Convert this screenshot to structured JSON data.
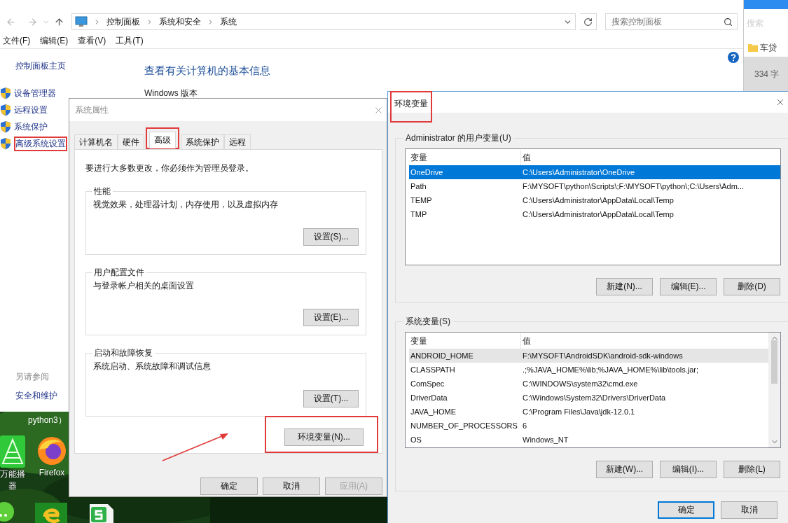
{
  "control_panel": {
    "breadcrumb": [
      "控制面板",
      "系统和安全",
      "系统"
    ],
    "search": {
      "placeholder": "搜索控制面板"
    },
    "menu": [
      "文件(F)",
      "编辑(E)",
      "查看(V)",
      "工具(T)"
    ],
    "sidebar": {
      "home": "控制面板主页",
      "items": [
        {
          "label": "设备管理器",
          "highlighted": false
        },
        {
          "label": "远程设置",
          "highlighted": false
        },
        {
          "label": "系统保护",
          "highlighted": false
        },
        {
          "label": "高级系统设置",
          "highlighted": true
        }
      ],
      "see_also_heading": "另请参阅",
      "see_also": [
        "安全和维护"
      ]
    },
    "heading": "查看有关计算机的基本信息",
    "section": "Windows 版本"
  },
  "side_app": {
    "search_placeholder": "搜索",
    "folder": "车贷",
    "word_count": "334 字"
  },
  "desktop": {
    "caption": "python3）",
    "icons": [
      {
        "kind": "triangle",
        "label_lines": [
          "万能播",
          "器"
        ]
      },
      {
        "kind": "firefox",
        "label_lines": [
          "Firefox"
        ]
      },
      {
        "kind": "chat"
      },
      {
        "kind": "e"
      },
      {
        "kind": "sheet"
      }
    ]
  },
  "system_properties": {
    "title": "系统属性",
    "tabs": [
      {
        "label": "计算机名",
        "selected": false,
        "highlighted": false
      },
      {
        "label": "硬件",
        "selected": false,
        "highlighted": false
      },
      {
        "label": "高级",
        "selected": true,
        "highlighted": true
      },
      {
        "label": "系统保护",
        "selected": false,
        "highlighted": false
      },
      {
        "label": "远程",
        "selected": false,
        "highlighted": false
      }
    ],
    "notice": "要进行大多数更改，你必须作为管理员登录。",
    "groups": [
      {
        "title": "性能",
        "description": "视觉效果，处理器计划，内存使用，以及虚拟内存",
        "button": "设置(S)..."
      },
      {
        "title": "用户配置文件",
        "description": "与登录帐户相关的桌面设置",
        "button": "设置(E)..."
      },
      {
        "title": "启动和故障恢复",
        "description": "系统启动、系统故障和调试信息",
        "button": "设置(T)..."
      }
    ],
    "env_button": {
      "label": "环境变量(N)...",
      "highlighted": true
    },
    "buttons": [
      {
        "label": "确定",
        "disabled": false
      },
      {
        "label": "取消",
        "disabled": false
      },
      {
        "label": "应用(A)",
        "disabled": true
      }
    ]
  },
  "environment_variables": {
    "title": "环境变量",
    "title_highlighted": true,
    "user_vars": {
      "label": "Administrator 的用户变量(U)",
      "focused": true,
      "columns": [
        "变量",
        "值"
      ],
      "rows": [
        {
          "name": "OneDrive",
          "value": "C:\\Users\\Administrator\\OneDrive",
          "selected": true
        },
        {
          "name": "Path",
          "value": "F:\\MYSOFT\\python\\Scripts\\;F:\\MYSOFT\\python\\;C:\\Users\\Adm...",
          "selected": false
        },
        {
          "name": "TEMP",
          "value": "C:\\Users\\Administrator\\AppData\\Local\\Temp",
          "selected": false
        },
        {
          "name": "TMP",
          "value": "C:\\Users\\Administrator\\AppData\\Local\\Temp",
          "selected": false
        }
      ],
      "buttons": [
        "新建(N)...",
        "编辑(E)...",
        "删除(D)"
      ]
    },
    "system_vars": {
      "label": "系统变量(S)",
      "focused": false,
      "columns": [
        "变量",
        "值"
      ],
      "rows": [
        {
          "name": "ANDROID_HOME",
          "value": "F:\\MYSOFT\\AndroidSDK\\android-sdk-windows",
          "selected": true
        },
        {
          "name": "CLASSPATH",
          "value": ".;%JAVA_HOME%\\lib;%JAVA_HOME%\\lib\\tools.jar;",
          "selected": false
        },
        {
          "name": "ComSpec",
          "value": "C:\\WINDOWS\\system32\\cmd.exe",
          "selected": false
        },
        {
          "name": "DriverData",
          "value": "C:\\Windows\\System32\\Drivers\\DriverData",
          "selected": false
        },
        {
          "name": "JAVA_HOME",
          "value": "C:\\Program Files\\Java\\jdk-12.0.1",
          "selected": false
        },
        {
          "name": "NUMBER_OF_PROCESSORS",
          "value": "6",
          "selected": false
        },
        {
          "name": "OS",
          "value": "Windows_NT",
          "selected": false
        }
      ],
      "buttons": [
        "新建(W)...",
        "编辑(I)...",
        "删除(L)"
      ]
    },
    "buttons": [
      {
        "label": "确定",
        "default": true
      },
      {
        "label": "取消",
        "default": false
      }
    ]
  }
}
